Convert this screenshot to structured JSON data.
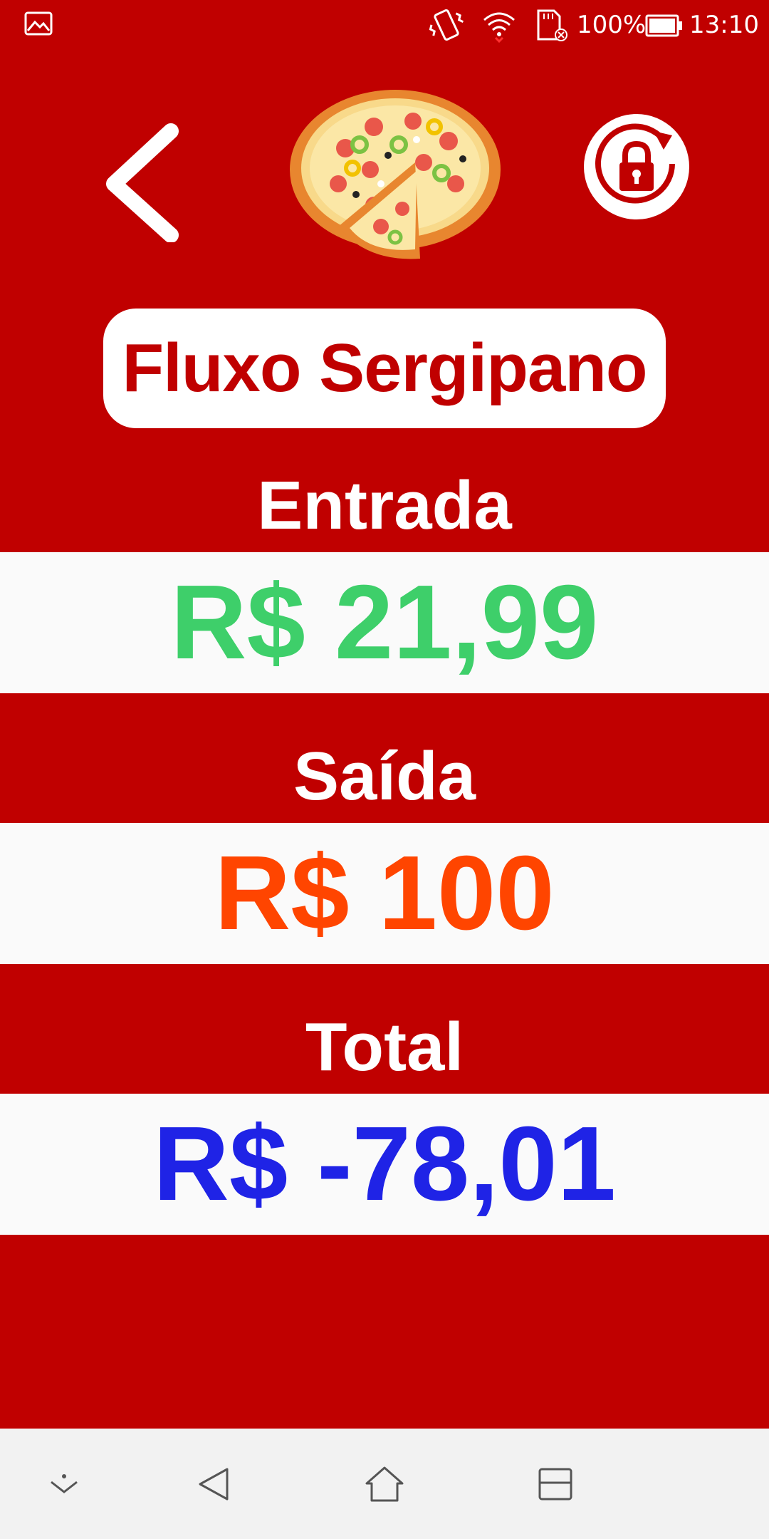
{
  "status_bar": {
    "battery_percent": "100%",
    "time": "13:10",
    "icons": [
      "image-icon",
      "vibrate-icon",
      "wifi-icon",
      "sd-card-icon",
      "battery-icon"
    ]
  },
  "header": {
    "back_icon": "chevron-left-icon",
    "logo_icon": "pizza-icon",
    "lock_icon": "lock-reset-icon"
  },
  "title": "Fluxo Sergipano",
  "entrada": {
    "label": "Entrada",
    "value": "R$ 21,99",
    "color": "#3ecf6a"
  },
  "saida": {
    "label": "Saída",
    "value": "R$ 100",
    "color": "#ff4500"
  },
  "total": {
    "label": "Total",
    "value": "R$ -78,01",
    "color": "#1f23e6"
  },
  "colors": {
    "background": "#c00000",
    "band": "#fafafa",
    "nav_bar": "#f2f2f2"
  },
  "nav_bar": {
    "icons": [
      "chevron-down-icon",
      "back-triangle-icon",
      "home-icon",
      "recents-icon"
    ]
  }
}
